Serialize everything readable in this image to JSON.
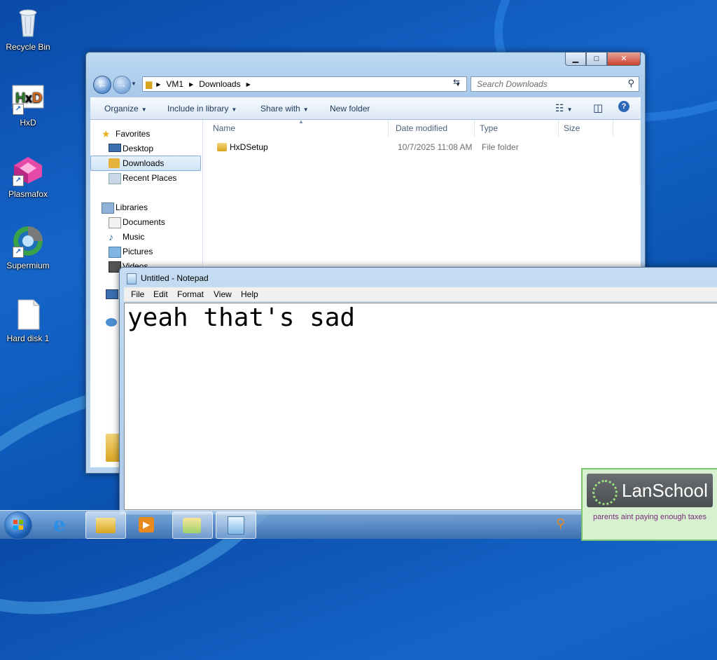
{
  "desktop": {
    "icons": [
      {
        "label": "Recycle Bin",
        "icon": "recycle-bin-icon"
      },
      {
        "label": "HxD",
        "icon": "hxd-icon"
      },
      {
        "label": "Plasmafox",
        "icon": "plasmafox-icon"
      },
      {
        "label": "Supermium",
        "icon": "supermium-icon"
      },
      {
        "label": "Hard disk 1",
        "icon": "file-icon"
      }
    ]
  },
  "explorer": {
    "breadcrumb": [
      "VM1",
      "Downloads"
    ],
    "search_placeholder": "Search Downloads",
    "toolbar": {
      "organize": "Organize",
      "include_in_library": "Include in library",
      "share_with": "Share with",
      "new_folder": "New folder"
    },
    "nav": {
      "favorites": "Favorites",
      "desktop": "Desktop",
      "downloads": "Downloads",
      "recent_places": "Recent Places",
      "libraries": "Libraries",
      "documents": "Documents",
      "music": "Music",
      "pictures": "Pictures",
      "videos": "Videos"
    },
    "columns": {
      "name": "Name",
      "date_modified": "Date modified",
      "type": "Type",
      "size": "Size"
    },
    "files": [
      {
        "name": "HxDSetup",
        "date_modified": "10/7/2025 11:08 AM",
        "type": "File folder",
        "size": ""
      }
    ]
  },
  "notepad": {
    "title": "Untitled - Notepad",
    "menu": {
      "file": "File",
      "edit": "Edit",
      "format": "Format",
      "view": "View",
      "help": "Help"
    },
    "content": "yeah that's sad"
  },
  "lanschool": {
    "brand": "LanSchool",
    "message": "parents aint paying enough taxes"
  }
}
